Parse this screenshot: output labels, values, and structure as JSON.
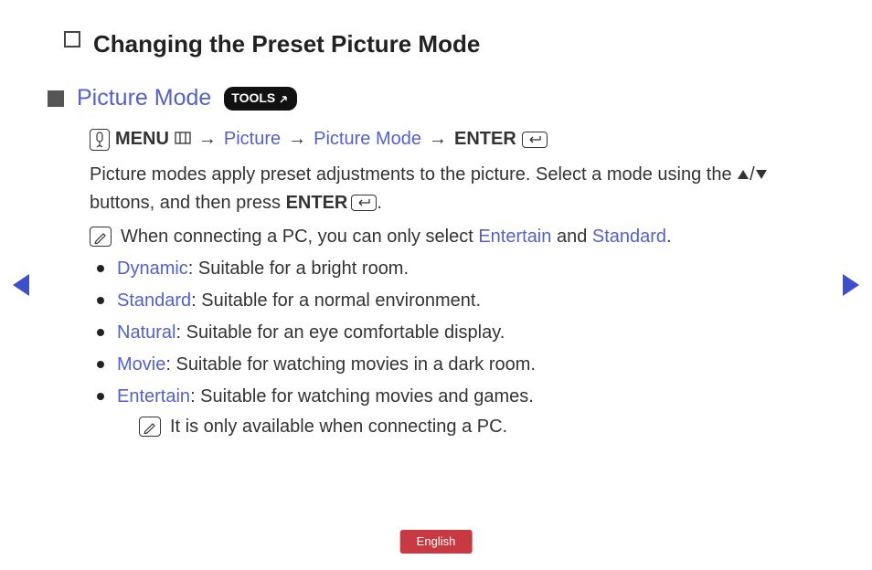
{
  "title": "Changing the Preset Picture Mode",
  "subhead": "Picture Mode",
  "tools_label": "TOOLS",
  "menu": {
    "menu_label": "MENU",
    "step1": "Picture",
    "step2": "Picture Mode",
    "enter_label": "ENTER",
    "arrow": "→"
  },
  "description": {
    "part1": "Picture modes apply preset adjustments to the picture. Select a mode using the ",
    "slash": "/",
    "part2": " buttons, and then press ",
    "enter_label": "ENTER",
    "period": "."
  },
  "pc_note": {
    "pre": "When connecting a PC, you can only select ",
    "entertain": "Entertain",
    "and": " and ",
    "standard": "Standard",
    "post": "."
  },
  "modes": [
    {
      "name": "Dynamic",
      "desc": ": Suitable for a bright room."
    },
    {
      "name": "Standard",
      "desc": ": Suitable for a normal environment."
    },
    {
      "name": "Natural",
      "desc": ": Suitable for an eye comfortable display."
    },
    {
      "name": "Movie",
      "desc": ": Suitable for watching movies in a dark room."
    },
    {
      "name": "Entertain",
      "desc": ": Suitable for watching movies and games."
    }
  ],
  "entertain_note": "It is only available when connecting a PC.",
  "language": "English"
}
